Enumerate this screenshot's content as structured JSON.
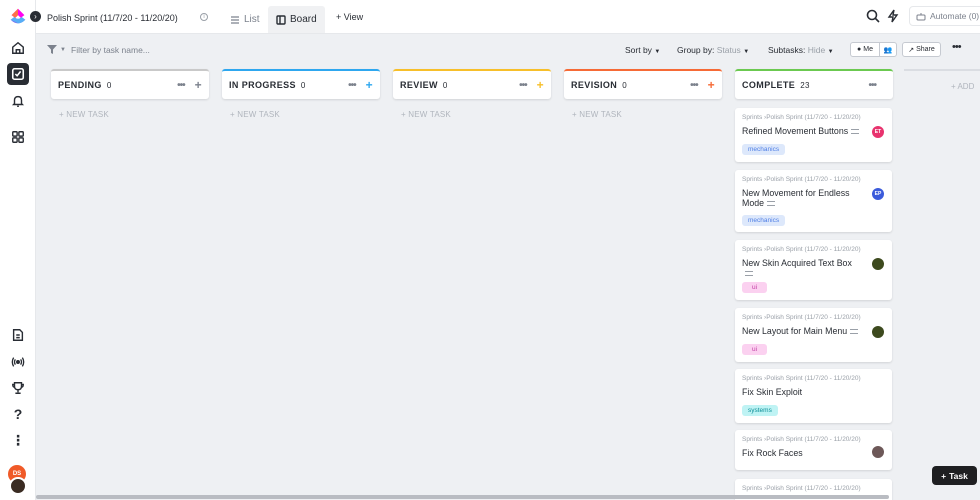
{
  "topbar": {
    "title": "Polish Sprint (11/7/20 - 11/20/20)",
    "tabs": [
      {
        "label": "List",
        "icon": "list-icon"
      },
      {
        "label": "Board",
        "icon": "board-icon"
      }
    ],
    "add_view": "+ View",
    "automate": "Automate (0)"
  },
  "toolbar": {
    "filter_placeholder": "Filter by task name...",
    "sort_label": "Sort by",
    "group_label": "Group by:",
    "group_value": "Status",
    "subtasks_label": "Subtasks:",
    "subtasks_value": "Hide",
    "me_label": "Me",
    "share_label": "Share"
  },
  "board": {
    "new_task_label": "+ NEW TASK",
    "add_column_label": "+ ADD",
    "columns": [
      {
        "name": "PENDING",
        "count": "0",
        "color": "#c9c9c9",
        "plus": "+",
        "plus_color": "#7c828d"
      },
      {
        "name": "IN PROGRESS",
        "count": "0",
        "color": "#2ea7ef",
        "plus": "+",
        "plus_color": "#2ea7ef"
      },
      {
        "name": "REVIEW",
        "count": "0",
        "color": "#f7bf2a",
        "plus": "+",
        "plus_color": "#f7bf2a"
      },
      {
        "name": "REVISION",
        "count": "0",
        "color": "#f66a36",
        "plus": "+",
        "plus_color": "#f66a36"
      },
      {
        "name": "COMPLETE",
        "count": "23",
        "color": "#6bc950",
        "plus": "",
        "plus_color": "#7c828d"
      }
    ],
    "cards": [
      {
        "crumb": "Sprints  ›Polish Sprint (11/7/20 - 11/20/20)",
        "title": "Refined Movement Buttons",
        "tag": "mechanics",
        "assignee": "ET",
        "assignee_color": "#e8336e"
      },
      {
        "crumb": "Sprints  ›Polish Sprint (11/7/20 - 11/20/20)",
        "title": "New Movement for Endless Mode",
        "tag": "mechanics",
        "assignee": "EP",
        "assignee_color": "#3b5bdb"
      },
      {
        "crumb": "Sprints  ›Polish Sprint (11/7/20 - 11/20/20)",
        "title": "New Skin Acquired Text Box",
        "tag": "ui",
        "assignee": "",
        "assignee_color": "#3d4a1e"
      },
      {
        "crumb": "Sprints  ›Polish Sprint (11/7/20 - 11/20/20)",
        "title": "New Layout for Main Menu",
        "tag": "ui",
        "assignee": "",
        "assignee_color": "#3d4a1e"
      },
      {
        "crumb": "Sprints  ›Polish Sprint (11/7/20 - 11/20/20)",
        "title": "Fix Skin Exploit",
        "tag": "systems",
        "assignee": "",
        "assignee_color": ""
      },
      {
        "crumb": "Sprints  ›Polish Sprint (11/7/20 - 11/20/20)",
        "title": "Fix Rock Faces",
        "tag": "",
        "assignee": "",
        "assignee_color": "#6d5858"
      },
      {
        "crumb": "Sprints  ›Polish Sprint (11/7/20 - 11/20/20)",
        "title": "",
        "tag": "",
        "assignee": "",
        "assignee_color": ""
      }
    ]
  },
  "task_button": "Task",
  "user_initials": "DS"
}
